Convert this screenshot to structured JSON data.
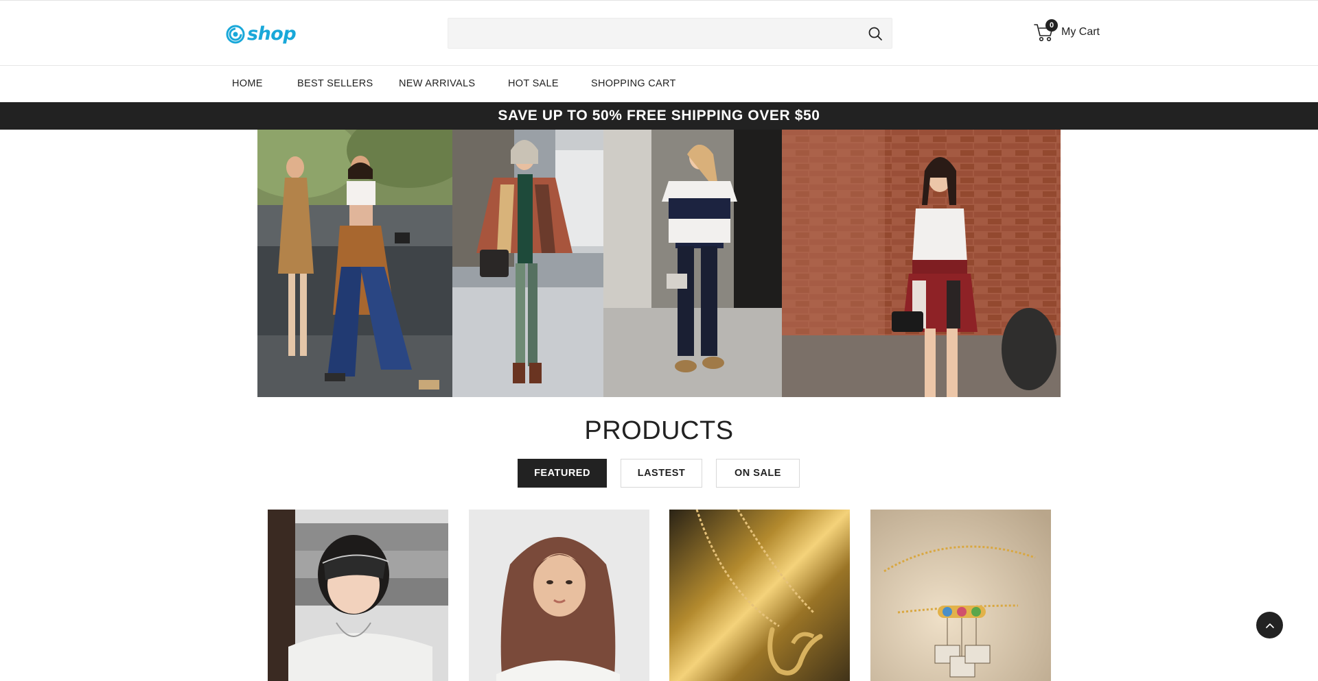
{
  "header": {
    "logo_text": "shop",
    "search": {
      "placeholder": "",
      "value": ""
    },
    "cart": {
      "count": "0",
      "label": "My Cart"
    }
  },
  "nav": {
    "items": [
      {
        "label": "HOME"
      },
      {
        "label": "BEST SELLERS"
      },
      {
        "label": "NEW ARRIVALS"
      },
      {
        "label": "HOT SALE"
      },
      {
        "label": "SHOPPING CART"
      }
    ]
  },
  "promo": {
    "text": "SAVE UP TO 50% FREE SHIPPING OVER $50"
  },
  "products": {
    "title": "PRODUCTS",
    "tabs": [
      {
        "label": "FEATURED",
        "active": true
      },
      {
        "label": "LASTEST",
        "active": false
      },
      {
        "label": "ON SALE",
        "active": false
      }
    ]
  },
  "icons": {
    "logo": "swirl-logo-icon",
    "search": "search-icon",
    "cart": "cart-icon",
    "back_to_top": "chevron-up-icon"
  },
  "colors": {
    "brand": "#19a8d9",
    "dark": "#222222",
    "search_bg": "#f4f4f4"
  }
}
